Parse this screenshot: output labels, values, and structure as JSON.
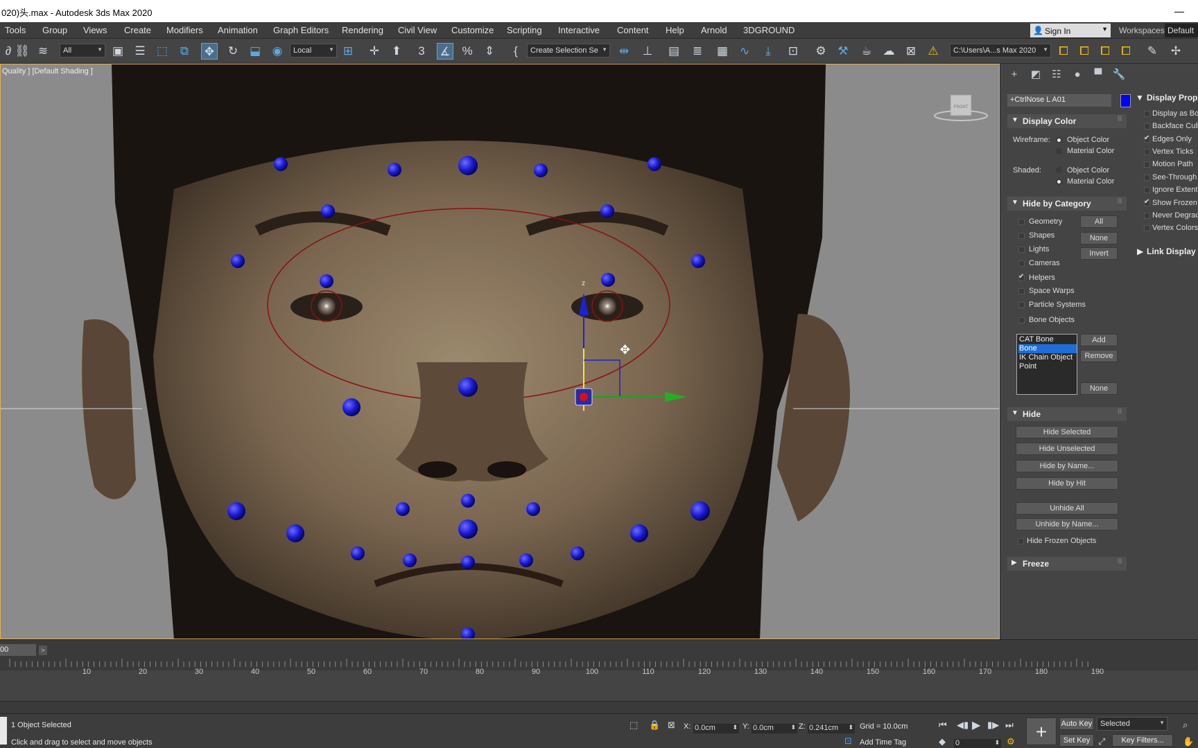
{
  "window": {
    "title": "020)头.max - Autodesk 3ds Max 2020"
  },
  "menu": {
    "items": [
      "Tools",
      "Group",
      "Views",
      "Create",
      "Modifiers",
      "Animation",
      "Graph Editors",
      "Rendering",
      "Civil View",
      "Customize",
      "Scripting",
      "Interactive",
      "Content",
      "Help",
      "Arnold",
      "3DGROUND"
    ],
    "sign_in": "Sign In",
    "workspaces_label": "Workspaces:",
    "workspace_value": "Default"
  },
  "toolbar": {
    "selection_filter": "All",
    "ref_coord": "Local",
    "named_selection": "Create Selection Se",
    "project_path": "C:\\Users\\A...s Max 2020"
  },
  "viewport": {
    "label": "Quality ] [Default Shading ]",
    "viewcube_label": "FRONT",
    "gizmo_axis": "z"
  },
  "command_panel": {
    "object_name": "+CtrlNose L A01",
    "object_color": "#0000ff",
    "display_color": {
      "title": "Display Color",
      "wireframe_label": "Wireframe:",
      "shaded_label": "Shaded:",
      "object_color": "Object Color",
      "material_color": "Material Color"
    },
    "hide_by_category": {
      "title": "Hide by Category",
      "categories": [
        {
          "label": "Geometry",
          "checked": false
        },
        {
          "label": "Shapes",
          "checked": false
        },
        {
          "label": "Lights",
          "checked": false
        },
        {
          "label": "Cameras",
          "checked": false
        },
        {
          "label": "Helpers",
          "checked": true
        },
        {
          "label": "Space Warps",
          "checked": false
        },
        {
          "label": "Particle Systems",
          "checked": false
        },
        {
          "label": "Bone Objects",
          "checked": false
        }
      ],
      "all_btn": "All",
      "none_btn": "None",
      "invert_btn": "Invert",
      "list": [
        "CAT Bone",
        "Bone",
        "IK Chain Object",
        "Point"
      ],
      "list_selected": "Bone",
      "add_btn": "Add",
      "remove_btn": "Remove",
      "list_none_btn": "None"
    },
    "hide": {
      "title": "Hide",
      "hide_selected": "Hide Selected",
      "hide_unselected": "Hide Unselected",
      "hide_by_name": "Hide by Name...",
      "hide_by_hit": "Hide by Hit",
      "unhide_all": "Unhide All",
      "unhide_by_name": "Unhide by Name...",
      "hide_frozen": "Hide Frozen Objects"
    },
    "freeze": {
      "title": "Freeze"
    }
  },
  "display_properties": {
    "title": "Display Prope",
    "items": [
      {
        "label": "Display as Box",
        "checked": false
      },
      {
        "label": "Backface Cull",
        "checked": false
      },
      {
        "label": "Edges Only",
        "checked": true
      },
      {
        "label": "Vertex Ticks",
        "checked": false
      },
      {
        "label": "Motion Path",
        "checked": false
      },
      {
        "label": "See-Through",
        "checked": false
      },
      {
        "label": "Ignore Extent",
        "checked": false
      },
      {
        "label": "Show Frozen",
        "checked": true
      },
      {
        "label": "Never Degrad",
        "checked": false
      },
      {
        "label": "Vertex Colors",
        "checked": false
      }
    ],
    "link_display": "Link Display"
  },
  "timeline": {
    "frame_display": "00",
    "ticks": [
      10,
      20,
      30,
      40,
      50,
      60,
      70,
      80,
      90,
      100,
      110,
      120,
      130,
      140,
      150,
      160,
      170,
      180,
      190
    ]
  },
  "status": {
    "selection": "1 Object Selected",
    "prompt": "Click and drag to select and move objects",
    "x_label": "X:",
    "x_value": "0.0cm",
    "y_label": "Y:",
    "y_value": "0.0cm",
    "z_label": "Z:",
    "z_value": "0.241cm",
    "grid": "Grid = 10.0cm",
    "add_time_tag": "Add Time Tag",
    "auto_key": "Auto Key",
    "selected_dd": "Selected",
    "set_key": "Set Key",
    "key_filters": "Key Filters...",
    "current_frame": "0"
  }
}
